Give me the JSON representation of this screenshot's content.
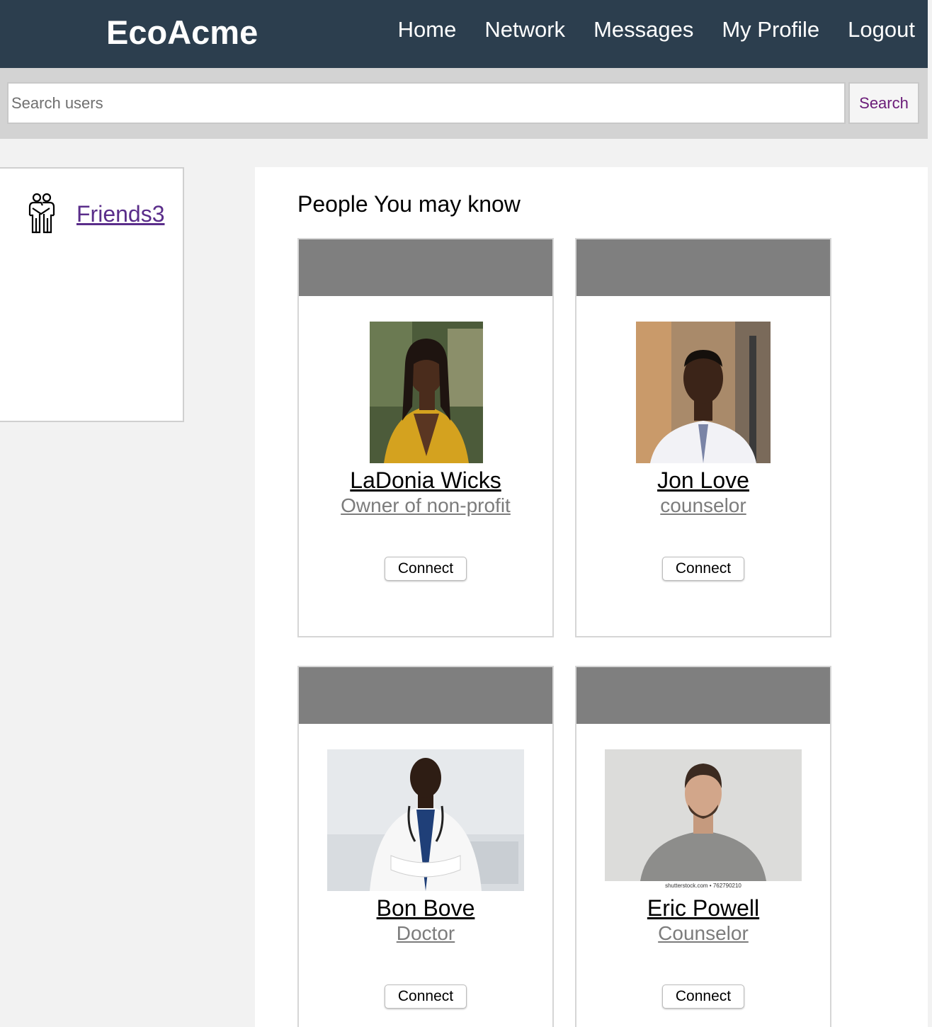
{
  "nav": {
    "brand": "EcoAcme",
    "links": [
      "Home",
      "Network",
      "Messages",
      "My Profile",
      "Logout"
    ]
  },
  "search": {
    "placeholder": "Search users",
    "button_label": "Search"
  },
  "sidebar": {
    "friends_label": "Friends3",
    "friends_icon": "friends-icon"
  },
  "main": {
    "section_title": "People You may know",
    "people": [
      {
        "name": "LaDonia Wicks",
        "title": "Owner of non-profit",
        "connect_label": "Connect"
      },
      {
        "name": "Jon Love",
        "title": "counselor",
        "connect_label": "Connect"
      },
      {
        "name": "Bon Bove",
        "title": "Doctor",
        "connect_label": "Connect"
      },
      {
        "name": "Eric Powell",
        "title": "Counselor",
        "connect_label": "Connect",
        "photo_credit": "shutterstock.com • 762790210"
      }
    ]
  },
  "colors": {
    "navbar": "#2c3e4e",
    "search_bar": "#d3d3d3",
    "card_banner": "#7f7f7f",
    "search_button_text": "#6a1b78",
    "link": "#5a2d8a"
  }
}
